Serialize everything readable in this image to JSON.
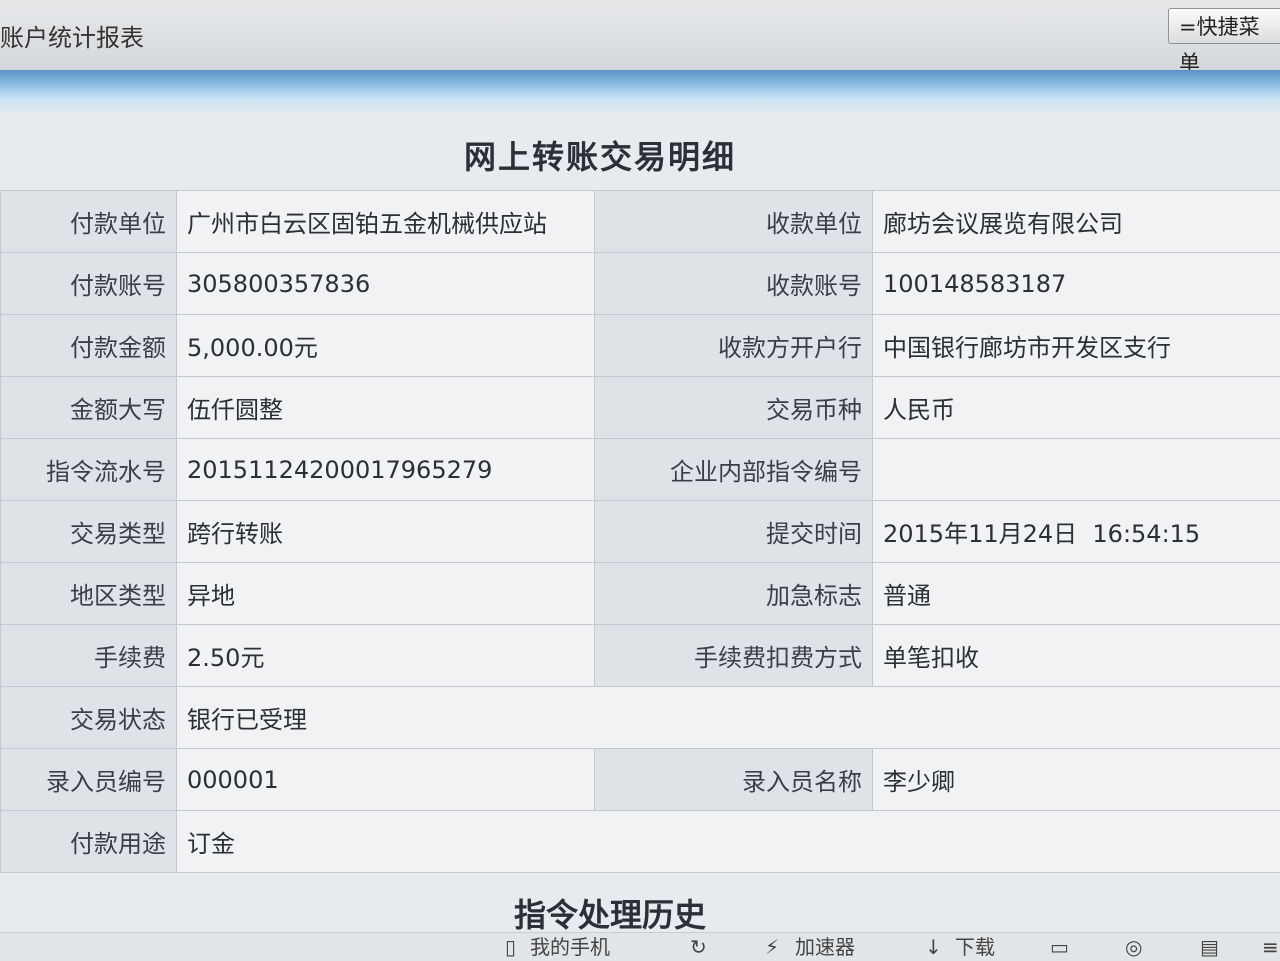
{
  "header": {
    "title": "账户统计报表",
    "quick_menu": "=快捷菜单"
  },
  "detail": {
    "title": "网上转账交易明细",
    "rows": [
      {
        "l1": "付款单位",
        "v1": "广州市白云区固铂五金机械供应站",
        "l2": "收款单位",
        "v2": "廊坊会议展览有限公司"
      },
      {
        "l1": "付款账号",
        "v1": "305800357836",
        "l2": "收款账号",
        "v2": "100148583187"
      },
      {
        "l1": "付款金额",
        "v1": "5,000.00元",
        "l2": "收款方开户行",
        "v2": "中国银行廊坊市开发区支行"
      },
      {
        "l1": "金额大写",
        "v1": "伍仟圆整",
        "l2": "交易币种",
        "v2": "人民币"
      },
      {
        "l1": "指令流水号",
        "v1": "20151124200017965279",
        "l2": "企业内部指令编号",
        "v2": ""
      },
      {
        "l1": "交易类型",
        "v1": "跨行转账",
        "l2": "提交时间",
        "v2": "2015年11月24日  16:54:15"
      },
      {
        "l1": "地区类型",
        "v1": "异地",
        "l2": "加急标志",
        "v2": "普通"
      },
      {
        "l1": "手续费",
        "v1": "2.50元",
        "l2": "手续费扣费方式",
        "v2": "单笔扣收"
      },
      {
        "l1": "交易状态",
        "v1": "银行已受理"
      },
      {
        "l1": "录入员编号",
        "v1": "000001",
        "l2": "录入员名称",
        "v2": "李少卿"
      },
      {
        "l1": "付款用途",
        "v1": "订金"
      }
    ]
  },
  "history": {
    "title": "指令处理历史"
  },
  "statusbar": {
    "items": [
      "我的手机",
      "加速器",
      "下载"
    ]
  }
}
